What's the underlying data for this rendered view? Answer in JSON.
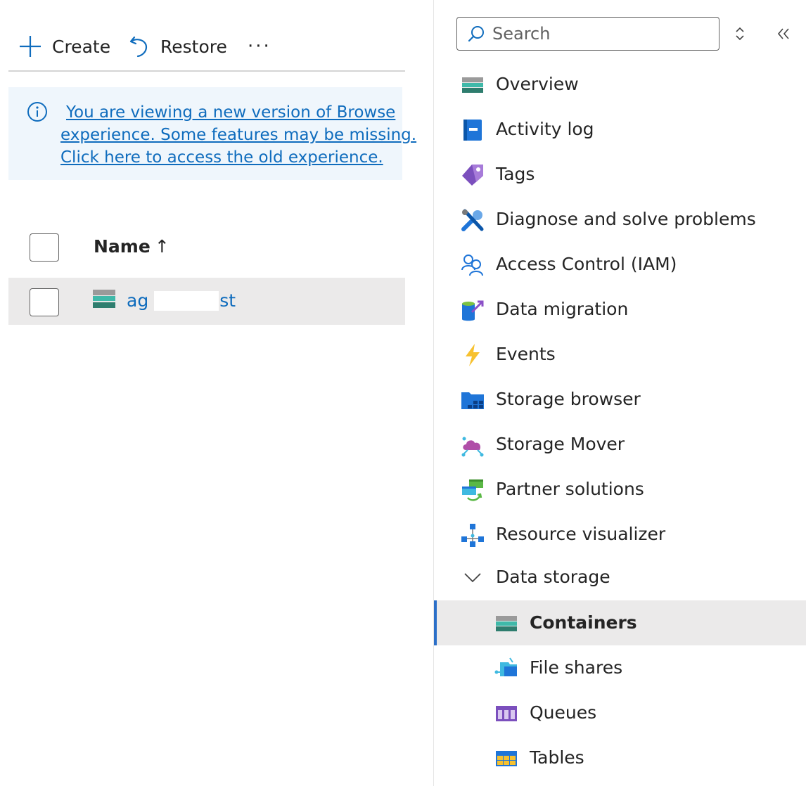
{
  "toolbar": {
    "create_label": "Create",
    "restore_label": "Restore",
    "more_label": "···"
  },
  "info_banner": {
    "line1": "You are viewing a new version of Browse",
    "line2": "experience. Some features may be missing.",
    "line3": "Click here to access the old experience."
  },
  "grid": {
    "column_name": "Name",
    "sort_arrow": "↑",
    "rows": [
      {
        "name_start": "ag",
        "name_end": "st"
      }
    ]
  },
  "search": {
    "placeholder": "Search"
  },
  "nav": {
    "items": [
      {
        "label": "Overview",
        "icon": "overview-icon"
      },
      {
        "label": "Activity log",
        "icon": "activity-log-icon"
      },
      {
        "label": "Tags",
        "icon": "tag-icon"
      },
      {
        "label": "Diagnose and solve problems",
        "icon": "wrench-icon"
      },
      {
        "label": "Access Control (IAM)",
        "icon": "people-icon"
      },
      {
        "label": "Data migration",
        "icon": "data-migration-icon"
      },
      {
        "label": "Events",
        "icon": "lightning-icon"
      },
      {
        "label": "Storage browser",
        "icon": "storage-browser-icon"
      },
      {
        "label": "Storage Mover",
        "icon": "cloud-icon"
      },
      {
        "label": "Partner solutions",
        "icon": "partner-icon"
      },
      {
        "label": "Resource visualizer",
        "icon": "hierarchy-icon"
      }
    ],
    "group": {
      "label": "Data storage",
      "expanded": true
    },
    "sub_items": [
      {
        "label": "Containers",
        "icon": "container-icon",
        "active": true
      },
      {
        "label": "File shares",
        "icon": "file-share-icon"
      },
      {
        "label": "Queues",
        "icon": "queue-icon"
      },
      {
        "label": "Tables",
        "icon": "table-icon"
      }
    ]
  },
  "colors": {
    "accent": "#0f6cbd",
    "banner_bg": "#eff6fc",
    "selected_bg": "#ebeaea",
    "active_bar": "#2b6fc8"
  }
}
